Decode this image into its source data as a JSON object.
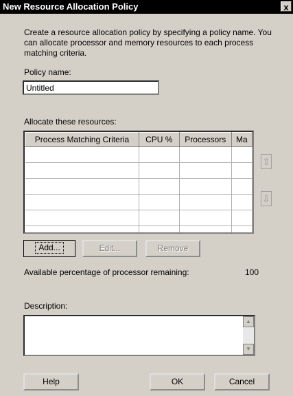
{
  "window": {
    "title": "New Resource Allocation Policy",
    "close_glyph": "x"
  },
  "intro": "Create a resource allocation policy by specifying a policy name. You can allocate processor and memory resources to each process matching criteria.",
  "policy_name": {
    "label": "Policy name:",
    "value": "Untitled"
  },
  "resources": {
    "label": "Allocate these resources:",
    "columns": [
      "Process Matching Criteria",
      "CPU %",
      "Processors",
      "Ma"
    ],
    "up_icon": "up-arrow-icon",
    "down_icon": "down-arrow-icon"
  },
  "buttons": {
    "add": "Add...",
    "edit": "Edit...",
    "remove": "Remove",
    "help": "Help",
    "ok": "OK",
    "cancel": "Cancel"
  },
  "available": {
    "label": "Available percentage of processor remaining:",
    "value": "100"
  },
  "description": {
    "label": "Description:",
    "value": ""
  }
}
